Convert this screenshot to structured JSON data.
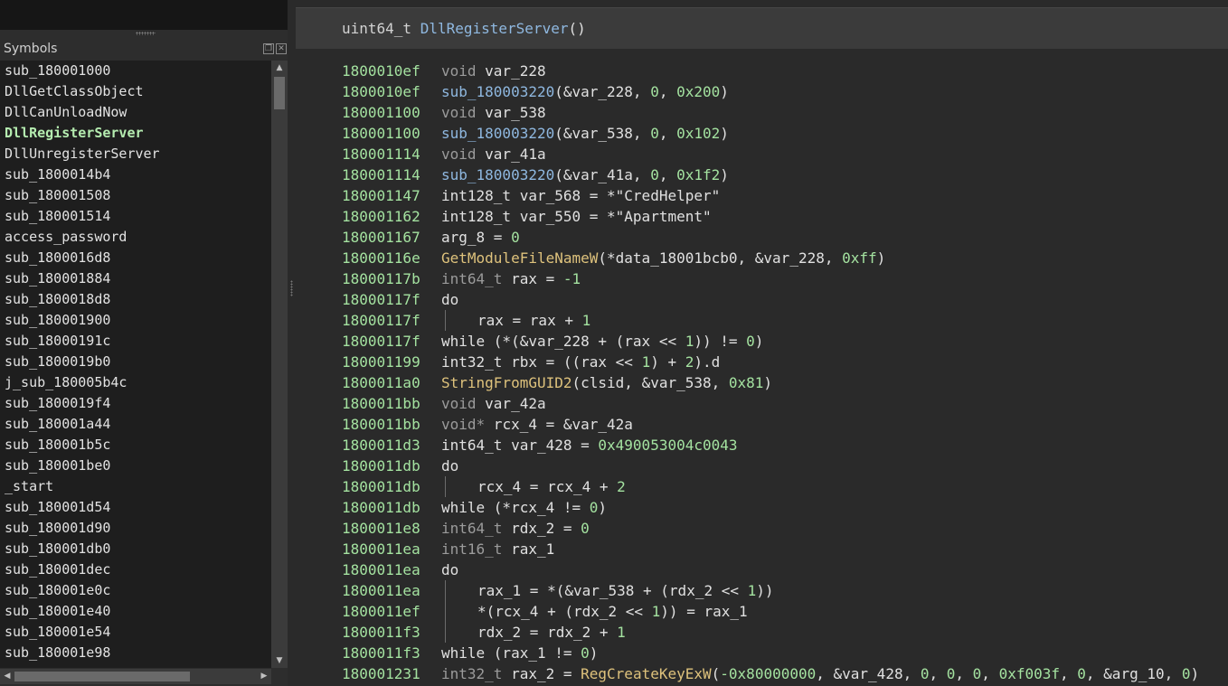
{
  "symbols_panel": {
    "title": "Symbols",
    "items": [
      "sub_180001000",
      "DllGetClassObject",
      "DllCanUnloadNow",
      "DllRegisterServer",
      "DllUnregisterServer",
      "sub_1800014b4",
      "sub_180001508",
      "sub_180001514",
      "access_password",
      "sub_1800016d8",
      "sub_180001884",
      "sub_1800018d8",
      "sub_180001900",
      "sub_18000191c",
      "sub_1800019b0",
      "j_sub_180005b4c",
      "sub_1800019f4",
      "sub_180001a44",
      "sub_180001b5c",
      "sub_180001be0",
      "_start",
      "sub_180001d54",
      "sub_180001d90",
      "sub_180001db0",
      "sub_180001dec",
      "sub_180001e0c",
      "sub_180001e40",
      "sub_180001e54",
      "sub_180001e98"
    ],
    "active_item": "DllRegisterServer"
  },
  "function_header": {
    "return_type": "uint64_t",
    "name": "DllRegisterServer",
    "params": "()"
  },
  "code_lines": [
    {
      "addr": "1800010ef",
      "indent": 0,
      "tokens": [
        [
          "t",
          "void"
        ],
        [
          "p",
          " var_228"
        ]
      ]
    },
    {
      "addr": "1800010ef",
      "indent": 0,
      "tokens": [
        [
          "s",
          "sub_180003220"
        ],
        [
          "p",
          "(&var_228, "
        ],
        [
          "n",
          "0"
        ],
        [
          "p",
          ", "
        ],
        [
          "n",
          "0x200"
        ],
        [
          "p",
          ")"
        ]
      ]
    },
    {
      "addr": "180001100",
      "indent": 0,
      "tokens": [
        [
          "t",
          "void"
        ],
        [
          "p",
          " var_538"
        ]
      ]
    },
    {
      "addr": "180001100",
      "indent": 0,
      "tokens": [
        [
          "s",
          "sub_180003220"
        ],
        [
          "p",
          "(&var_538, "
        ],
        [
          "n",
          "0"
        ],
        [
          "p",
          ", "
        ],
        [
          "n",
          "0x102"
        ],
        [
          "p",
          ")"
        ]
      ]
    },
    {
      "addr": "180001114",
      "indent": 0,
      "tokens": [
        [
          "t",
          "void"
        ],
        [
          "p",
          " var_41a"
        ]
      ]
    },
    {
      "addr": "180001114",
      "indent": 0,
      "tokens": [
        [
          "s",
          "sub_180003220"
        ],
        [
          "p",
          "(&var_41a, "
        ],
        [
          "n",
          "0"
        ],
        [
          "p",
          ", "
        ],
        [
          "n",
          "0x1f2"
        ],
        [
          "p",
          ")"
        ]
      ]
    },
    {
      "addr": "180001147",
      "indent": 0,
      "tokens": [
        [
          "p",
          "int128_t var_568 = *\"CredHelper\""
        ]
      ]
    },
    {
      "addr": "180001162",
      "indent": 0,
      "tokens": [
        [
          "p",
          "int128_t var_550 = *\"Apartment\""
        ]
      ]
    },
    {
      "addr": "180001167",
      "indent": 0,
      "tokens": [
        [
          "p",
          "arg_8 = "
        ],
        [
          "n",
          "0"
        ]
      ]
    },
    {
      "addr": "18000116e",
      "indent": 0,
      "tokens": [
        [
          "f",
          "GetModuleFileNameW"
        ],
        [
          "p",
          "(*data_18001bcb0, &var_228, "
        ],
        [
          "n",
          "0xff"
        ],
        [
          "p",
          ")"
        ]
      ]
    },
    {
      "addr": "18000117b",
      "indent": 0,
      "tokens": [
        [
          "t",
          "int64_t"
        ],
        [
          "p",
          " rax = "
        ],
        [
          "n",
          "-1"
        ]
      ]
    },
    {
      "addr": "18000117f",
      "indent": 0,
      "tokens": [
        [
          "p",
          "do"
        ]
      ]
    },
    {
      "addr": "18000117f",
      "indent": 1,
      "tokens": [
        [
          "p",
          "rax = rax + "
        ],
        [
          "n",
          "1"
        ]
      ]
    },
    {
      "addr": "18000117f",
      "indent": 0,
      "tokens": [
        [
          "p",
          "while (*(&var_228 + (rax << "
        ],
        [
          "n",
          "1"
        ],
        [
          "p",
          ")) != "
        ],
        [
          "n",
          "0"
        ],
        [
          "p",
          ")"
        ]
      ]
    },
    {
      "addr": "180001199",
      "indent": 0,
      "tokens": [
        [
          "p",
          "int32_t rbx = ((rax << "
        ],
        [
          "n",
          "1"
        ],
        [
          "p",
          ") + "
        ],
        [
          "n",
          "2"
        ],
        [
          "p",
          ").d"
        ]
      ]
    },
    {
      "addr": "1800011a0",
      "indent": 0,
      "tokens": [
        [
          "f",
          "StringFromGUID2"
        ],
        [
          "p",
          "(clsid, &var_538, "
        ],
        [
          "n",
          "0x81"
        ],
        [
          "p",
          ")"
        ]
      ]
    },
    {
      "addr": "1800011bb",
      "indent": 0,
      "tokens": [
        [
          "t",
          "void"
        ],
        [
          "p",
          " var_42a"
        ]
      ]
    },
    {
      "addr": "1800011bb",
      "indent": 0,
      "tokens": [
        [
          "t",
          "void*"
        ],
        [
          "p",
          " rcx_4 = &var_42a"
        ]
      ]
    },
    {
      "addr": "1800011d3",
      "indent": 0,
      "tokens": [
        [
          "p",
          "int64_t var_428 = "
        ],
        [
          "n",
          "0x490053004c0043"
        ]
      ]
    },
    {
      "addr": "1800011db",
      "indent": 0,
      "tokens": [
        [
          "p",
          "do"
        ]
      ]
    },
    {
      "addr": "1800011db",
      "indent": 1,
      "tokens": [
        [
          "p",
          "rcx_4 = rcx_4 + "
        ],
        [
          "n",
          "2"
        ]
      ]
    },
    {
      "addr": "1800011db",
      "indent": 0,
      "tokens": [
        [
          "p",
          "while (*rcx_4 != "
        ],
        [
          "n",
          "0"
        ],
        [
          "p",
          ")"
        ]
      ]
    },
    {
      "addr": "1800011e8",
      "indent": 0,
      "tokens": [
        [
          "t",
          "int64_t"
        ],
        [
          "p",
          " rdx_2 = "
        ],
        [
          "n",
          "0"
        ]
      ]
    },
    {
      "addr": "1800011ea",
      "indent": 0,
      "tokens": [
        [
          "t",
          "int16_t"
        ],
        [
          "p",
          " rax_1"
        ]
      ]
    },
    {
      "addr": "1800011ea",
      "indent": 0,
      "tokens": [
        [
          "p",
          "do"
        ]
      ]
    },
    {
      "addr": "1800011ea",
      "indent": 1,
      "tokens": [
        [
          "p",
          "rax_1 = *(&var_538 + (rdx_2 << "
        ],
        [
          "n",
          "1"
        ],
        [
          "p",
          "))"
        ]
      ]
    },
    {
      "addr": "1800011ef",
      "indent": 1,
      "tokens": [
        [
          "p",
          "*(rcx_4 + (rdx_2 << "
        ],
        [
          "n",
          "1"
        ],
        [
          "p",
          ")) = rax_1"
        ]
      ]
    },
    {
      "addr": "1800011f3",
      "indent": 1,
      "tokens": [
        [
          "p",
          "rdx_2 = rdx_2 + "
        ],
        [
          "n",
          "1"
        ]
      ]
    },
    {
      "addr": "1800011f3",
      "indent": 0,
      "tokens": [
        [
          "p",
          "while (rax_1 != "
        ],
        [
          "n",
          "0"
        ],
        [
          "p",
          ")"
        ]
      ]
    },
    {
      "addr": "180001231",
      "indent": 0,
      "tokens": [
        [
          "t",
          "int32_t"
        ],
        [
          "p",
          " rax_2 = "
        ],
        [
          "f",
          "RegCreateKeyExW"
        ],
        [
          "p",
          "("
        ],
        [
          "n",
          "-0x80000000"
        ],
        [
          "p",
          ", &var_428, "
        ],
        [
          "n",
          "0"
        ],
        [
          "p",
          ", "
        ],
        [
          "n",
          "0"
        ],
        [
          "p",
          ", "
        ],
        [
          "n",
          "0"
        ],
        [
          "p",
          ", "
        ],
        [
          "n",
          "0xf003f"
        ],
        [
          "p",
          ", "
        ],
        [
          "n",
          "0"
        ],
        [
          "p",
          ", &arg_10, "
        ],
        [
          "n",
          "0"
        ],
        [
          "p",
          ")"
        ]
      ]
    }
  ],
  "colors": {
    "address": "#a4e2a0",
    "type_keyword": "#9b9b9b",
    "import_function": "#dec27c",
    "sub_function": "#8fb8e0",
    "number": "#a4e2a0",
    "active_symbol": "#b5ecb0"
  },
  "icons": [
    "float-window-icon",
    "close-icon",
    "scroll-up-icon",
    "scroll-down-icon",
    "scroll-left-icon",
    "scroll-right-icon"
  ]
}
